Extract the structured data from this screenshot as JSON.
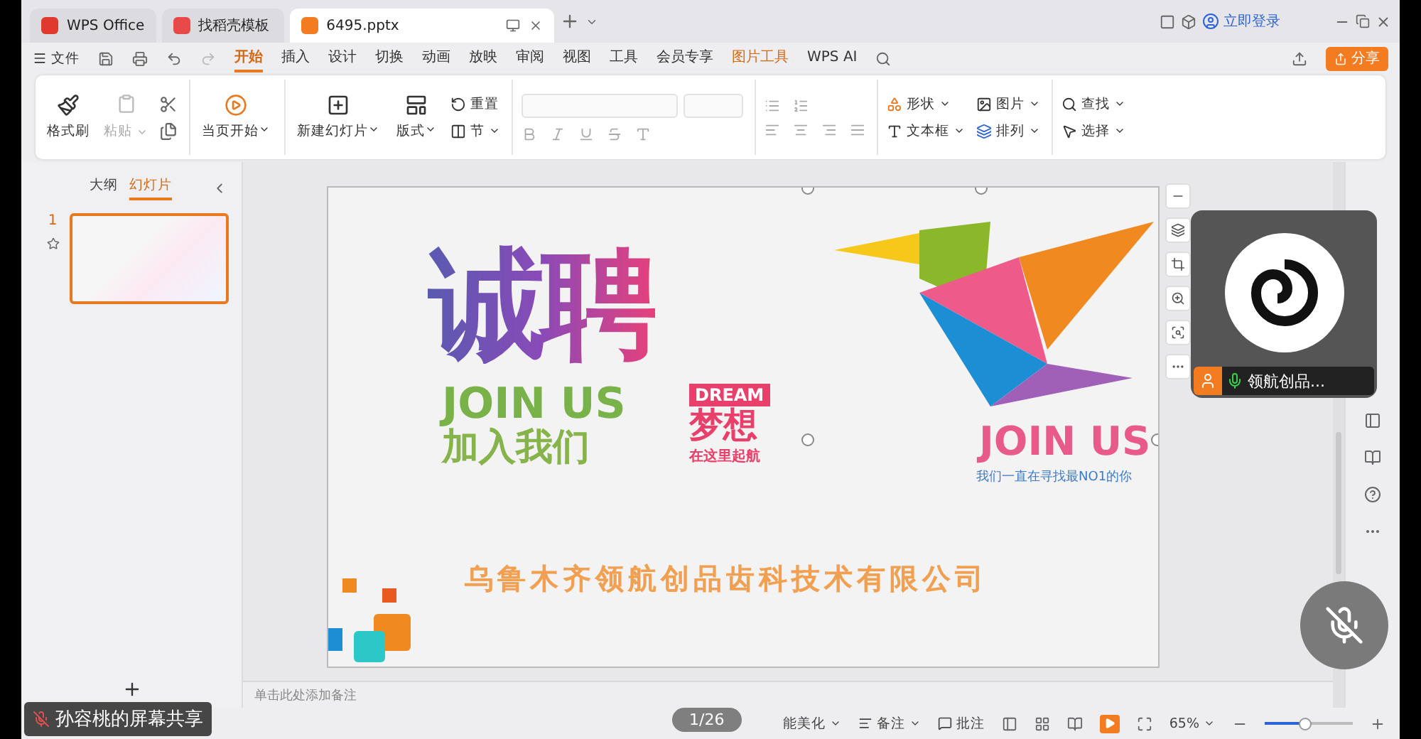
{
  "tabs": [
    {
      "label": "WPS Office",
      "kind": "home",
      "selected": false
    },
    {
      "label": "找稻壳模板",
      "kind": "template",
      "selected": false
    },
    {
      "label": "6495.pptx",
      "kind": "doc",
      "selected": true
    }
  ],
  "account": {
    "login": "立即登录"
  },
  "menu": {
    "file": "文件",
    "tabs": [
      {
        "label": "开始",
        "kind": "normal",
        "selected": true
      },
      {
        "label": "插入",
        "kind": "normal",
        "selected": false
      },
      {
        "label": "设计",
        "kind": "normal",
        "selected": false
      },
      {
        "label": "切换",
        "kind": "normal",
        "selected": false
      },
      {
        "label": "动画",
        "kind": "normal",
        "selected": false
      },
      {
        "label": "放映",
        "kind": "normal",
        "selected": false
      },
      {
        "label": "审阅",
        "kind": "normal",
        "selected": false
      },
      {
        "label": "视图",
        "kind": "normal",
        "selected": false
      },
      {
        "label": "工具",
        "kind": "normal",
        "selected": false
      },
      {
        "label": "会员专享",
        "kind": "normal",
        "selected": false
      },
      {
        "label": "图片工具",
        "kind": "tool",
        "selected": false
      },
      {
        "label": "WPS AI",
        "kind": "ai",
        "selected": false
      }
    ],
    "share": "分享"
  },
  "ribbon": {
    "clipboard": {
      "format_painter": "格式刷",
      "paste": "粘贴",
      "paste_disabled": true
    },
    "slideshow": {
      "from_current": "当页开始"
    },
    "slides": {
      "new_slide": "新建幻灯片",
      "layout": "版式",
      "reset": "重置",
      "section": "节"
    },
    "drawing": {
      "shape": "形状",
      "picture": "图片",
      "textbox": "文本框",
      "arrange": "排列"
    },
    "editing": {
      "find": "查找",
      "select": "选择"
    }
  },
  "panel": {
    "tabs": [
      {
        "label": "大纲",
        "selected": false
      },
      {
        "label": "幻灯片",
        "selected": true
      }
    ],
    "slides": [
      {
        "number": "1",
        "selected": true
      }
    ]
  },
  "slide": {
    "title": "诚聘",
    "join": "JOIN US",
    "join_cn": "加入我们",
    "dream": "DREAM",
    "dream_cn": "梦想",
    "dream_sub": "在这里起航",
    "right_join": "JOIN US",
    "right_sub": "我们一直在寻找最NO1的你",
    "company": "乌鲁木齐领航创品齿科技术有限公司"
  },
  "notes": {
    "placeholder": "单击此处添加备注"
  },
  "status": {
    "beautify": "能美化",
    "notes": "备注",
    "comments": "批注",
    "zoom": "65%",
    "zoom_slider": {
      "level": 0.45
    }
  },
  "overlay": {
    "share_label": "孙容桃的屏幕共享",
    "page": "1/26",
    "participant": {
      "name": "领航创品...",
      "muted": false
    },
    "mic_muted": true
  }
}
